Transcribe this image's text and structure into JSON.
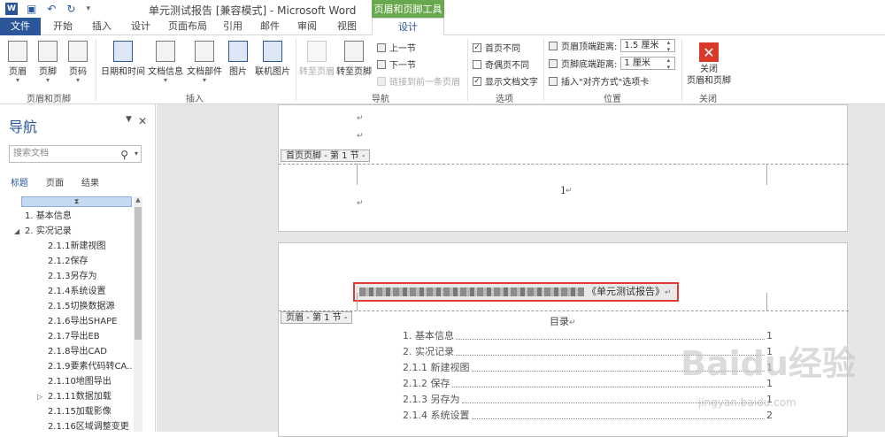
{
  "window": {
    "title": "单元测试报告 [兼容模式] - Microsoft Word",
    "context_header": "页眉和页脚工具"
  },
  "tabs": [
    "文件",
    "开始",
    "插入",
    "设计",
    "页面布局",
    "引用",
    "邮件",
    "审阅",
    "视图",
    "设计"
  ],
  "ribbon": {
    "hf_group": {
      "label": "页眉和页脚",
      "buttons": [
        "页眉",
        "页脚",
        "页码"
      ]
    },
    "insert_group": {
      "label": "插入",
      "buttons": [
        "日期和时间",
        "文档信息",
        "文档部件",
        "图片",
        "联机图片"
      ]
    },
    "nav_group": {
      "label": "导航",
      "goto_header": "转至页眉",
      "goto_footer": "转至页脚",
      "prev": "上一节",
      "next": "下一节",
      "link_prev": "链接到前一条页眉"
    },
    "options_group": {
      "label": "选项",
      "first_page": "首页不同",
      "odd_even": "奇偶页不同",
      "show_text": "显示文档文字"
    },
    "position_group": {
      "label": "位置",
      "header_top_label": "页眉顶端距离:",
      "header_top_value": "1.5 厘米",
      "footer_bottom_label": "页脚底端距离:",
      "footer_bottom_value": "1 厘米",
      "insert_align_tab": "插入\"对齐方式\"选项卡"
    },
    "close_group": {
      "label": "关闭",
      "button": "关闭\n页眉和页脚"
    }
  },
  "nav_pane": {
    "title": "导航",
    "search_placeholder": "搜索文档",
    "tabs": [
      "标题",
      "页面",
      "结果"
    ],
    "tree": [
      {
        "text": "1. 基本信息",
        "level": 1
      },
      {
        "text": "2. 实况记录",
        "level": 1,
        "expanded": true
      },
      {
        "text": "2.1.1新建视图",
        "level": 3
      },
      {
        "text": "2.1.2保存",
        "level": 3
      },
      {
        "text": "2.1.3另存为",
        "level": 3
      },
      {
        "text": "2.1.4系统设置",
        "level": 3
      },
      {
        "text": "2.1.5切换数据源",
        "level": 3
      },
      {
        "text": "2.1.6导出SHAPE",
        "level": 3
      },
      {
        "text": "2.1.7导出EB",
        "level": 3
      },
      {
        "text": "2.1.8导出CAD",
        "level": 3
      },
      {
        "text": "2.1.9要素代码转CA...",
        "level": 3
      },
      {
        "text": "2.1.10地图导出",
        "level": 3
      },
      {
        "text": "2.1.11数据加载",
        "level": 3,
        "collapsed": true
      },
      {
        "text": "2.1.15加载影像",
        "level": 3
      },
      {
        "text": "2.1.16区域调整变更",
        "level": 3
      }
    ]
  },
  "document": {
    "footer_tag": "首页页脚 - 第 1 节 -",
    "footer_page_number": "1",
    "header_tag": "页眉 - 第 1 节 -",
    "header_text": "《单元测试报告》",
    "toc_title": "目录",
    "toc": [
      {
        "label": "1.  基本信息",
        "page": "1"
      },
      {
        "label": "2.  实况记录",
        "page": "1"
      },
      {
        "label": "2.1.1 新建视图",
        "page": "1"
      },
      {
        "label": "2.1.2 保存",
        "page": "1"
      },
      {
        "label": "2.1.3 另存为",
        "page": "1"
      },
      {
        "label": "2.1.4 系统设置",
        "page": "2"
      }
    ]
  },
  "watermark": {
    "main": "Baidu经验",
    "sub": "jingyan.baidu.com"
  }
}
